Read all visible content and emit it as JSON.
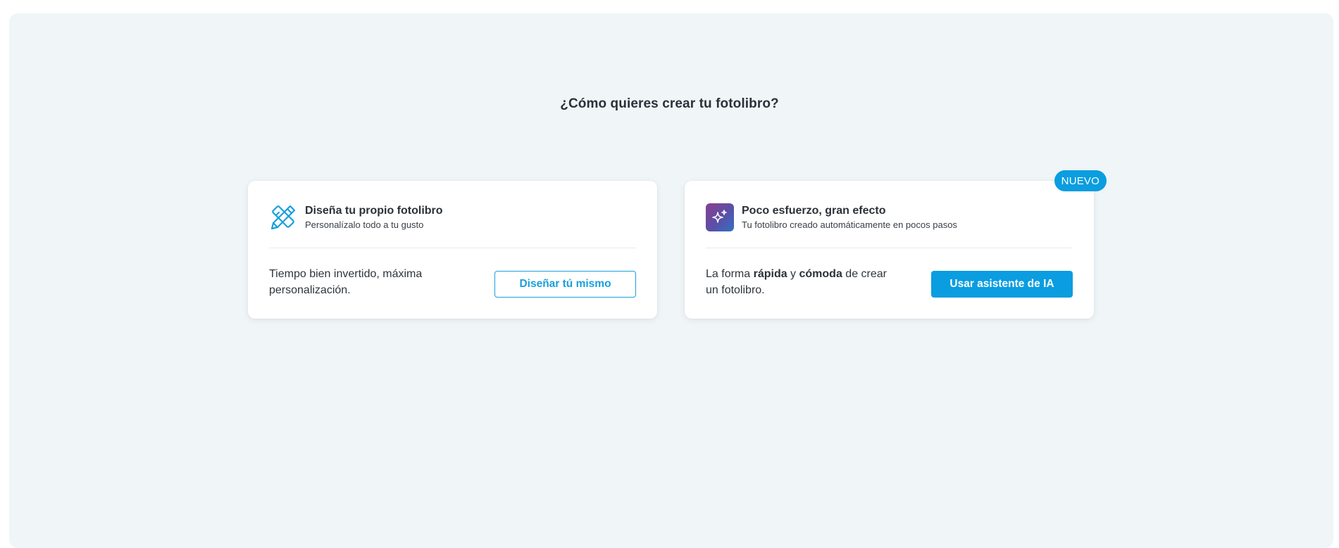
{
  "page": {
    "title": "¿Cómo quieres crear tu fotolibro?"
  },
  "colors": {
    "accent": "#0a9de0",
    "background_panel": "#f0f5f8",
    "card_background": "#ffffff",
    "text_primary": "#2b3138",
    "ai_icon_gradient": [
      "#8a3f8f",
      "#5a4fa8",
      "#2f73c2"
    ]
  },
  "cards": {
    "design_own": {
      "icon": "pencil-ruler-icon",
      "title": "Diseña tu propio fotolibro",
      "subtitle": "Personalízalo todo a tu gusto",
      "description": "Tiempo bien invertido, máxima personalización.",
      "button_label": "Diseñar tú mismo"
    },
    "ai_assistant": {
      "icon": "sparkles-icon",
      "badge": "NUEVO",
      "title": "Poco esfuerzo, gran efecto",
      "subtitle": "Tu fotolibro creado automáticamente en pocos pasos",
      "description_parts": [
        "La forma ",
        "rápida",
        " y ",
        "cómoda",
        " de crear un fotolibro."
      ],
      "button_label": "Usar asistente de IA"
    }
  }
}
